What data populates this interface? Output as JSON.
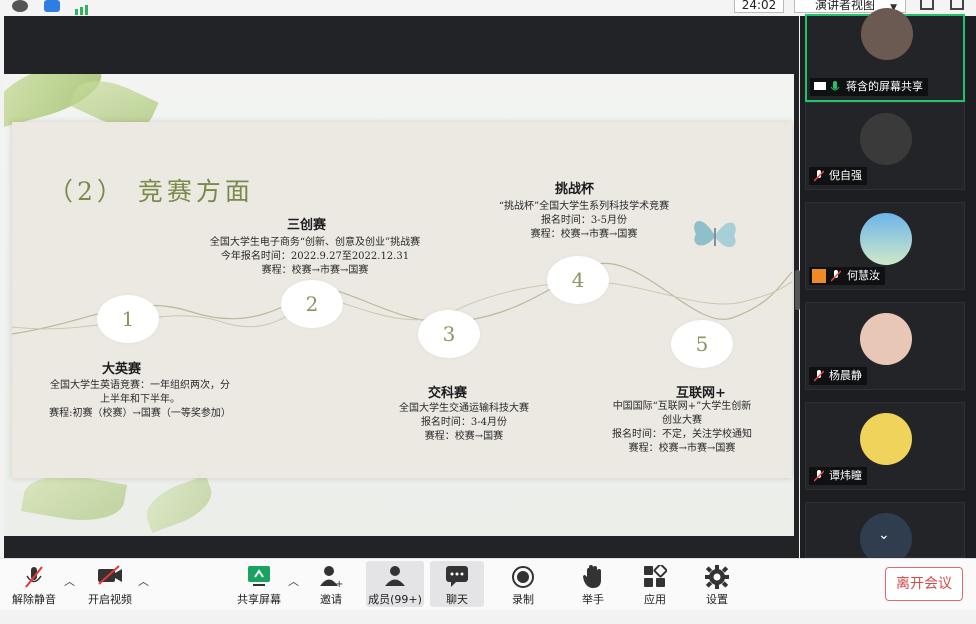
{
  "topbar": {
    "timer": "24:02",
    "view_mode": "演讲者视图"
  },
  "slide": {
    "title": "（2） 竞赛方面",
    "nodes": [
      {
        "number": "1",
        "title": "大英赛",
        "lines": [
          "全国大学生英语竞赛：一年组织两次，分",
          "上半年和下半年。",
          "赛程:初赛（校赛）→国赛（一等奖参加）"
        ]
      },
      {
        "number": "2",
        "title": "三创赛",
        "lines": [
          "全国大学生电子商务“创新、创意及创业”挑战赛",
          "今年报名时间：2022.9.27至2022.12.31",
          "赛程：校赛→市赛→国赛"
        ]
      },
      {
        "number": "3",
        "title": "交科赛",
        "lines": [
          "全国大学生交通运输科技大赛",
          "报名时间：3-4月份",
          "赛程：校赛→国赛"
        ]
      },
      {
        "number": "4",
        "title": "挑战杯",
        "lines": [
          "“挑战杯”全国大学生系列科技学术竞赛",
          "报名时间：3-5月份",
          "赛程：校赛→市赛→国赛"
        ]
      },
      {
        "number": "5",
        "title": "互联网+",
        "lines": [
          "中国国际“互联网+”大学生创新",
          "创业大赛",
          "报名时间：不定，关注学校通知",
          "赛程：校赛→市赛→国赛"
        ]
      }
    ]
  },
  "participants": [
    {
      "name": "蒋含的屏幕共享",
      "avatar_color": "#6b5a52",
      "active": true
    },
    {
      "name": "倪自强",
      "avatar_color": "#3a3a3a",
      "active": false
    },
    {
      "name": "何慧汝",
      "avatar_color": "#5aa0d8",
      "active": false
    },
    {
      "name": "杨晨静",
      "avatar_color": "#e9c7b7",
      "active": false
    },
    {
      "name": "谭炜瞳",
      "avatar_color": "#f0d35a",
      "active": false
    },
    {
      "name": "",
      "avatar_color": "#2f3d4f",
      "active": false
    }
  ],
  "toolbar": {
    "unmute": "解除静音",
    "start_video": "开启视频",
    "share_screen": "共享屏幕",
    "invite": "邀请",
    "members": "成员(99+)",
    "chat": "聊天",
    "record": "录制",
    "raise_hand": "举手",
    "apps": "应用",
    "settings": "设置",
    "leave": "离开会议"
  },
  "colors": {
    "active_border": "#22c46a",
    "leave_text": "#d64a4a",
    "slide_accent": "#7a8a4a"
  }
}
